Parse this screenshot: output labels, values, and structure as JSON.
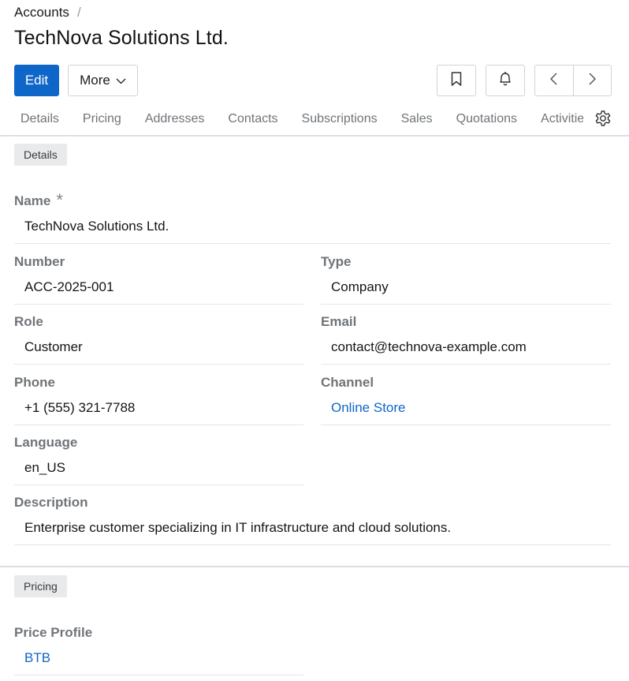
{
  "breadcrumb": {
    "parent": "Accounts",
    "separator": "/"
  },
  "title": "TechNova Solutions Ltd.",
  "toolbar": {
    "edit_label": "Edit",
    "more_label": "More"
  },
  "tabs": [
    {
      "label": "Details"
    },
    {
      "label": "Pricing"
    },
    {
      "label": "Addresses"
    },
    {
      "label": "Contacts"
    },
    {
      "label": "Subscriptions"
    },
    {
      "label": "Sales"
    },
    {
      "label": "Quotations"
    },
    {
      "label": "Activities"
    }
  ],
  "sections": {
    "details": {
      "label": "Details",
      "fields": {
        "name": {
          "label": "Name",
          "required": "*",
          "value": "TechNova Solutions Ltd."
        },
        "number": {
          "label": "Number",
          "value": "ACC-2025-001"
        },
        "type": {
          "label": "Type",
          "value": "Company"
        },
        "role": {
          "label": "Role",
          "value": "Customer"
        },
        "email": {
          "label": "Email",
          "value": "contact@technova-example.com"
        },
        "phone": {
          "label": "Phone",
          "value": "+1 (555) 321-7788"
        },
        "channel": {
          "label": "Channel",
          "value": "Online Store"
        },
        "language": {
          "label": "Language",
          "value": "en_US"
        },
        "description": {
          "label": "Description",
          "value": "Enterprise customer specializing in IT infrastructure and cloud solutions."
        }
      }
    },
    "pricing": {
      "label": "Pricing",
      "fields": {
        "price_profile": {
          "label": "Price Profile",
          "value": "BTB"
        }
      }
    }
  },
  "icons": {
    "more": "chevron-down-icon",
    "bookmark": "bookmark-icon",
    "bell": "bell-icon",
    "prev": "chevron-left-icon",
    "next": "chevron-right-icon",
    "settings": "gear-icon"
  },
  "colors": {
    "primary": "#0f66c9",
    "link": "#0f66c9"
  }
}
